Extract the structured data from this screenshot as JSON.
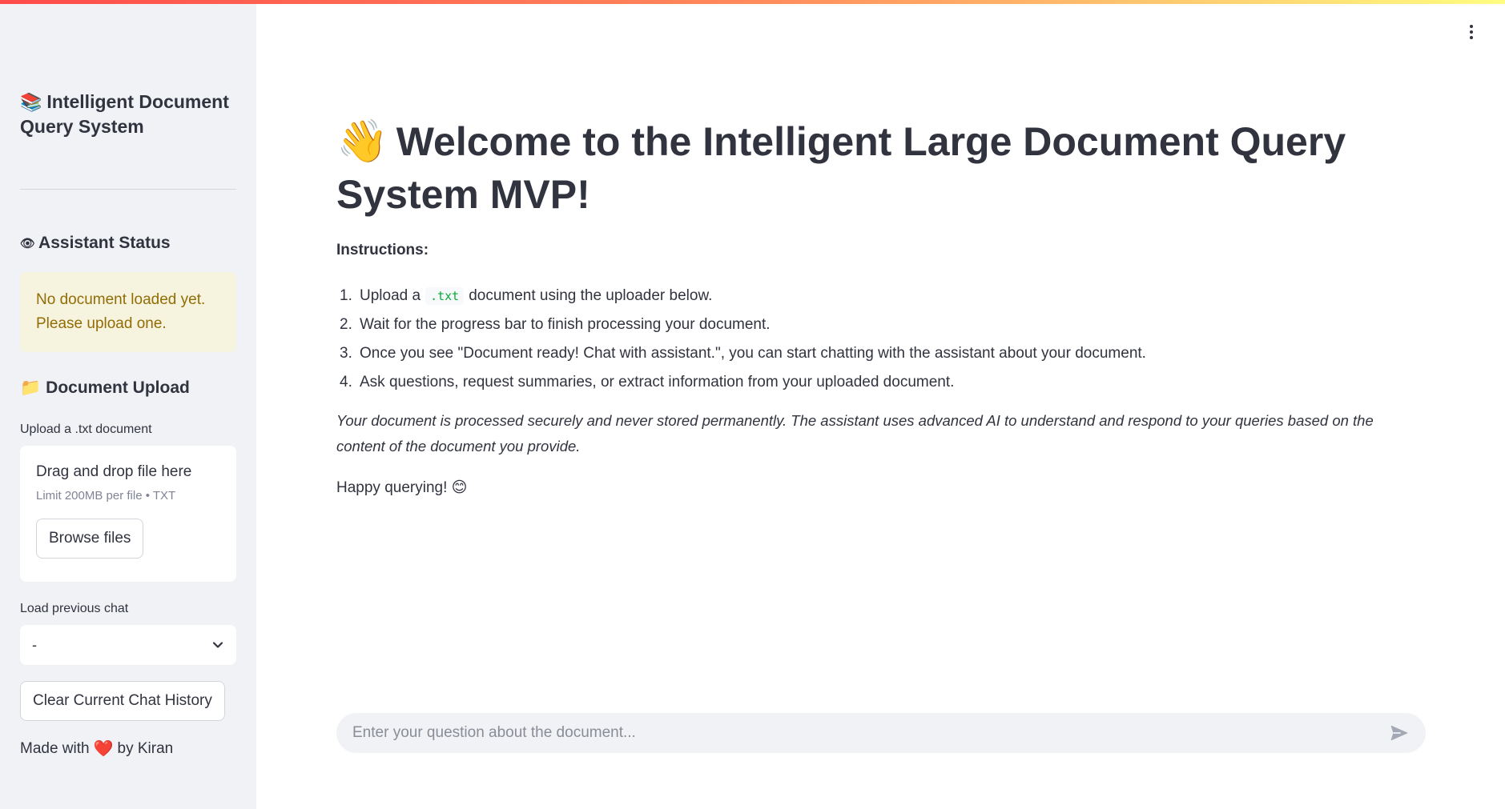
{
  "sidebar": {
    "title_emoji": "📚",
    "title": "Intelligent Document Query System",
    "status_icon": "👁",
    "status_heading": "Assistant Status",
    "status_message": "No document loaded yet. Please upload one.",
    "upload_emoji": "📁",
    "upload_heading": "Document Upload",
    "upload_label": "Upload a .txt document",
    "dropzone_title": "Drag and drop file here",
    "dropzone_limit": "Limit 200MB per file • TXT",
    "browse_label": "Browse files",
    "select_label": "Load previous chat",
    "select_value": "-",
    "clear_label": "Clear Current Chat History",
    "made_with_prefix": "Made with",
    "heart": "❤️",
    "made_with_suffix": "by Kiran"
  },
  "main": {
    "title_emoji": "👋",
    "title": "Welcome to the Intelligent Large Document Query System MVP!",
    "instructions_heading": "Instructions:",
    "steps": [
      {
        "num": "1.",
        "pre": "Upload a",
        "code": ".txt",
        "post": "document using the uploader below."
      },
      {
        "num": "2.",
        "text": "Wait for the progress bar to finish processing your document."
      },
      {
        "num": "3.",
        "text": "Once you see \"Document ready! Chat with assistant.\", you can start chatting with the assistant about your document."
      },
      {
        "num": "4.",
        "text": "Ask questions, request summaries, or extract information from your uploaded document."
      }
    ],
    "note": "Your document is processed securely and never stored permanently. The assistant uses advanced AI to understand and respond to your queries based on the content of the document you provide.",
    "happy": "Happy querying! 😊"
  },
  "chat": {
    "placeholder": "Enter your question about the document..."
  },
  "icons": {
    "menu": "kebab-menu-icon",
    "send": "send-icon",
    "dropdown": "chevron-down-icon"
  },
  "colors": {
    "sidebar_bg": "#f0f2f6",
    "alert_bg": "#f6f4df",
    "alert_text": "#926c05",
    "code_text": "#09ab3b",
    "text": "#31333f"
  }
}
